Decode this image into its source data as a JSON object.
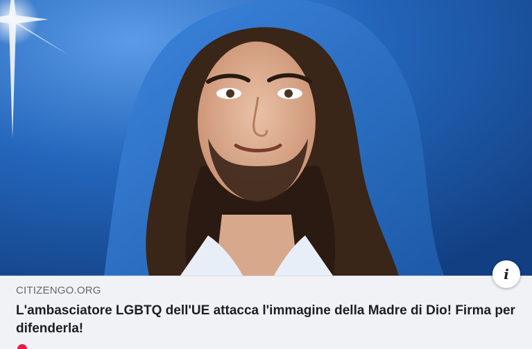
{
  "link_preview": {
    "image_alt": "Portrait with blue veil",
    "domain": "CITIZENGO.ORG",
    "headline": "L'ambasciatore LGBTQ dell'UE attacca l'immagine della Madre di Dio! Firma per difenderla!",
    "info_icon": "info-icon"
  },
  "colors": {
    "background_blue": "#1f5fb0",
    "veil_blue": "#2a6fca",
    "meta_bg": "#f0f2f5",
    "domain_text": "#65676b",
    "headline_text": "#1c1e21"
  }
}
